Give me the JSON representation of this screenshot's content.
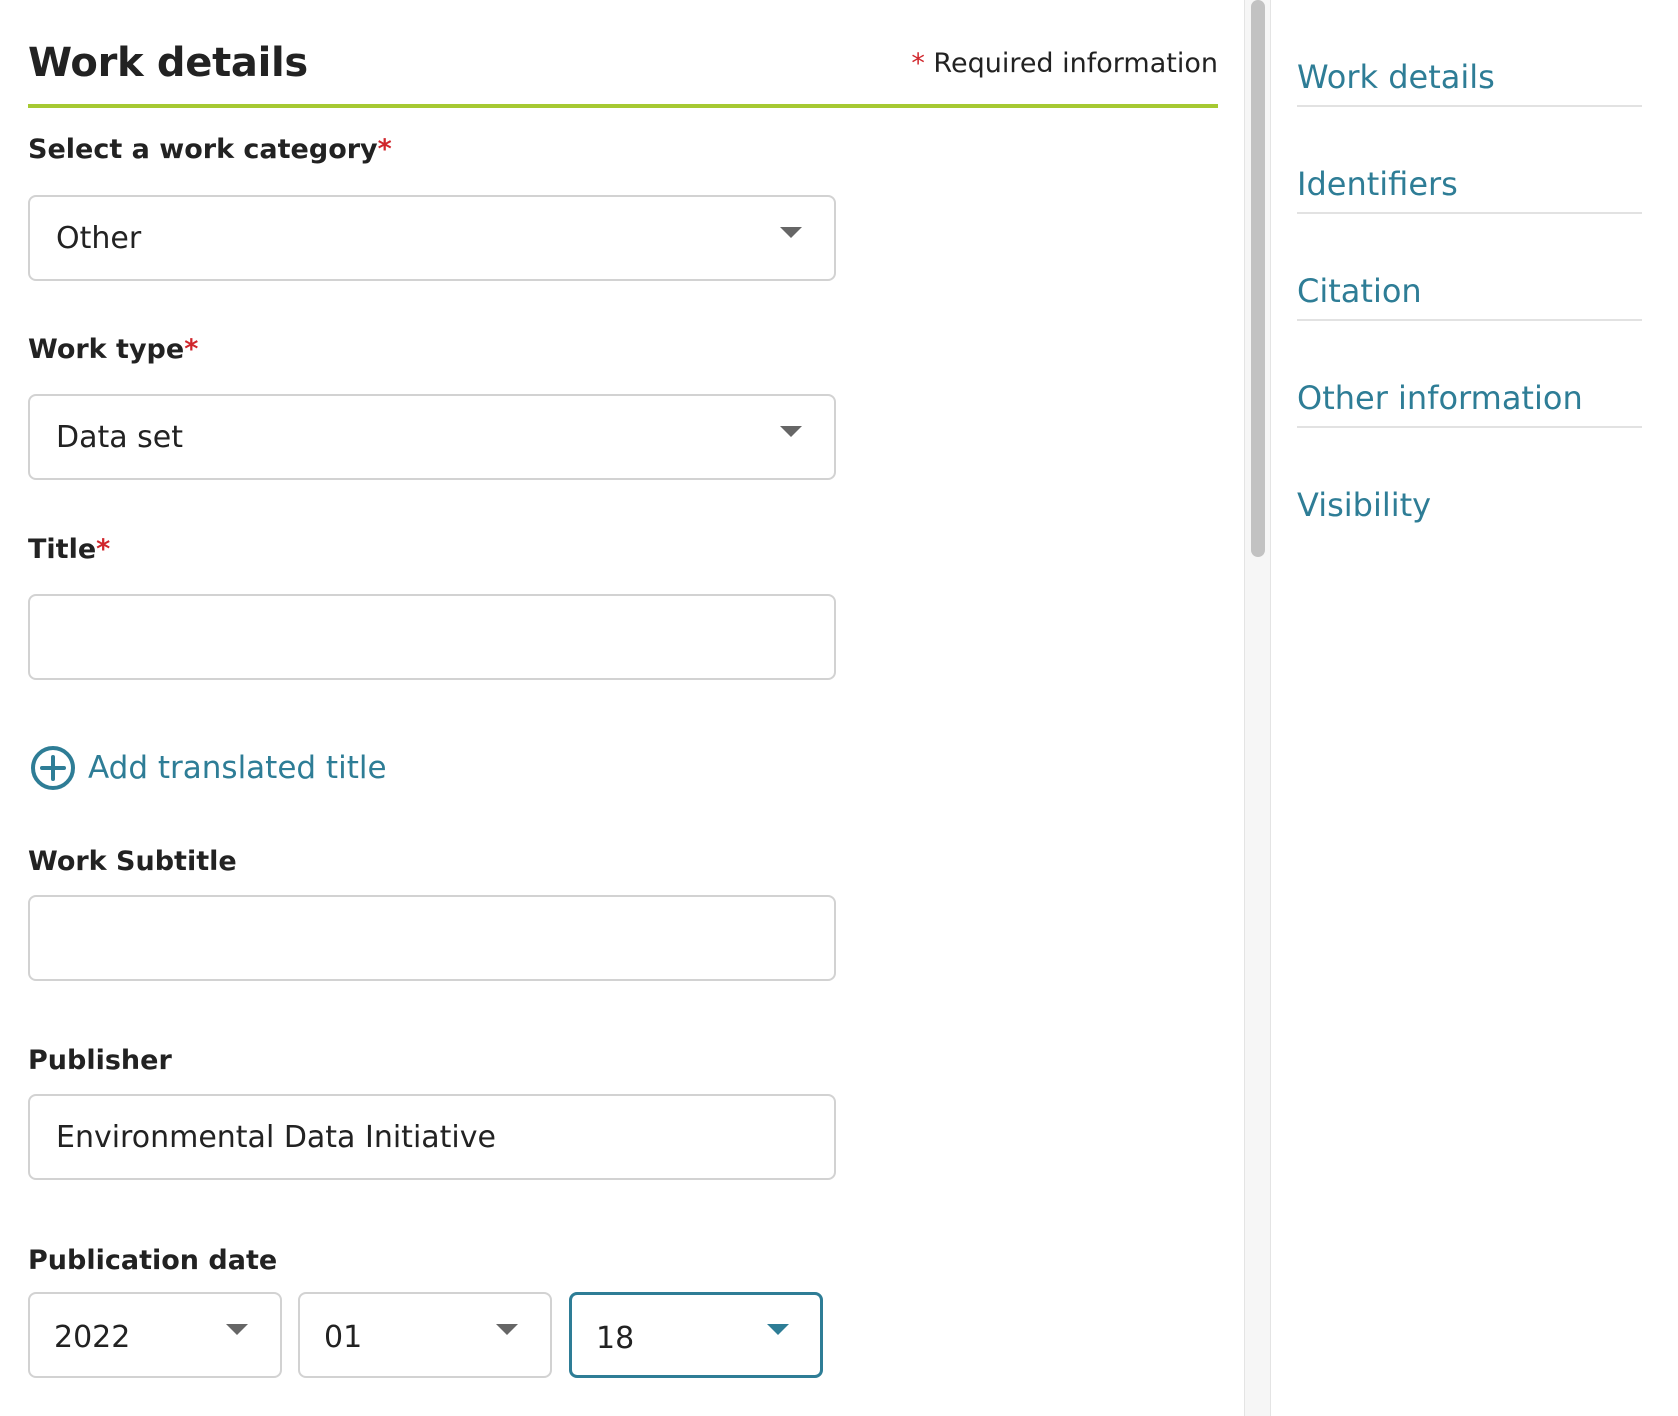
{
  "header": {
    "title": "Work details",
    "required_star": "*",
    "required_note": "Required information"
  },
  "fields": {
    "work_category": {
      "label": "Select a work category",
      "star": "*",
      "value": "Other"
    },
    "work_type": {
      "label": "Work type",
      "star": "*",
      "value": "Data set"
    },
    "title": {
      "label": "Title",
      "star": "*",
      "value": ""
    },
    "add_translated_title": "Add translated title",
    "subtitle": {
      "label": "Work Subtitle",
      "value": ""
    },
    "publisher": {
      "label": "Publisher",
      "value": "Environmental Data Initiative"
    },
    "publication_date": {
      "label": "Publication date",
      "year": "2022",
      "month": "01",
      "day": "18"
    }
  },
  "side_nav": {
    "items": [
      {
        "label": "Work details"
      },
      {
        "label": "Identifiers"
      },
      {
        "label": "Citation"
      },
      {
        "label": "Other information"
      },
      {
        "label": "Visibility"
      }
    ]
  },
  "colors": {
    "accent_link": "#2e7d96",
    "header_rule": "#a6c932",
    "required_star": "#d0262c"
  },
  "icons": {
    "dropdown": "chevron-down-icon",
    "add": "plus-circle-icon"
  }
}
